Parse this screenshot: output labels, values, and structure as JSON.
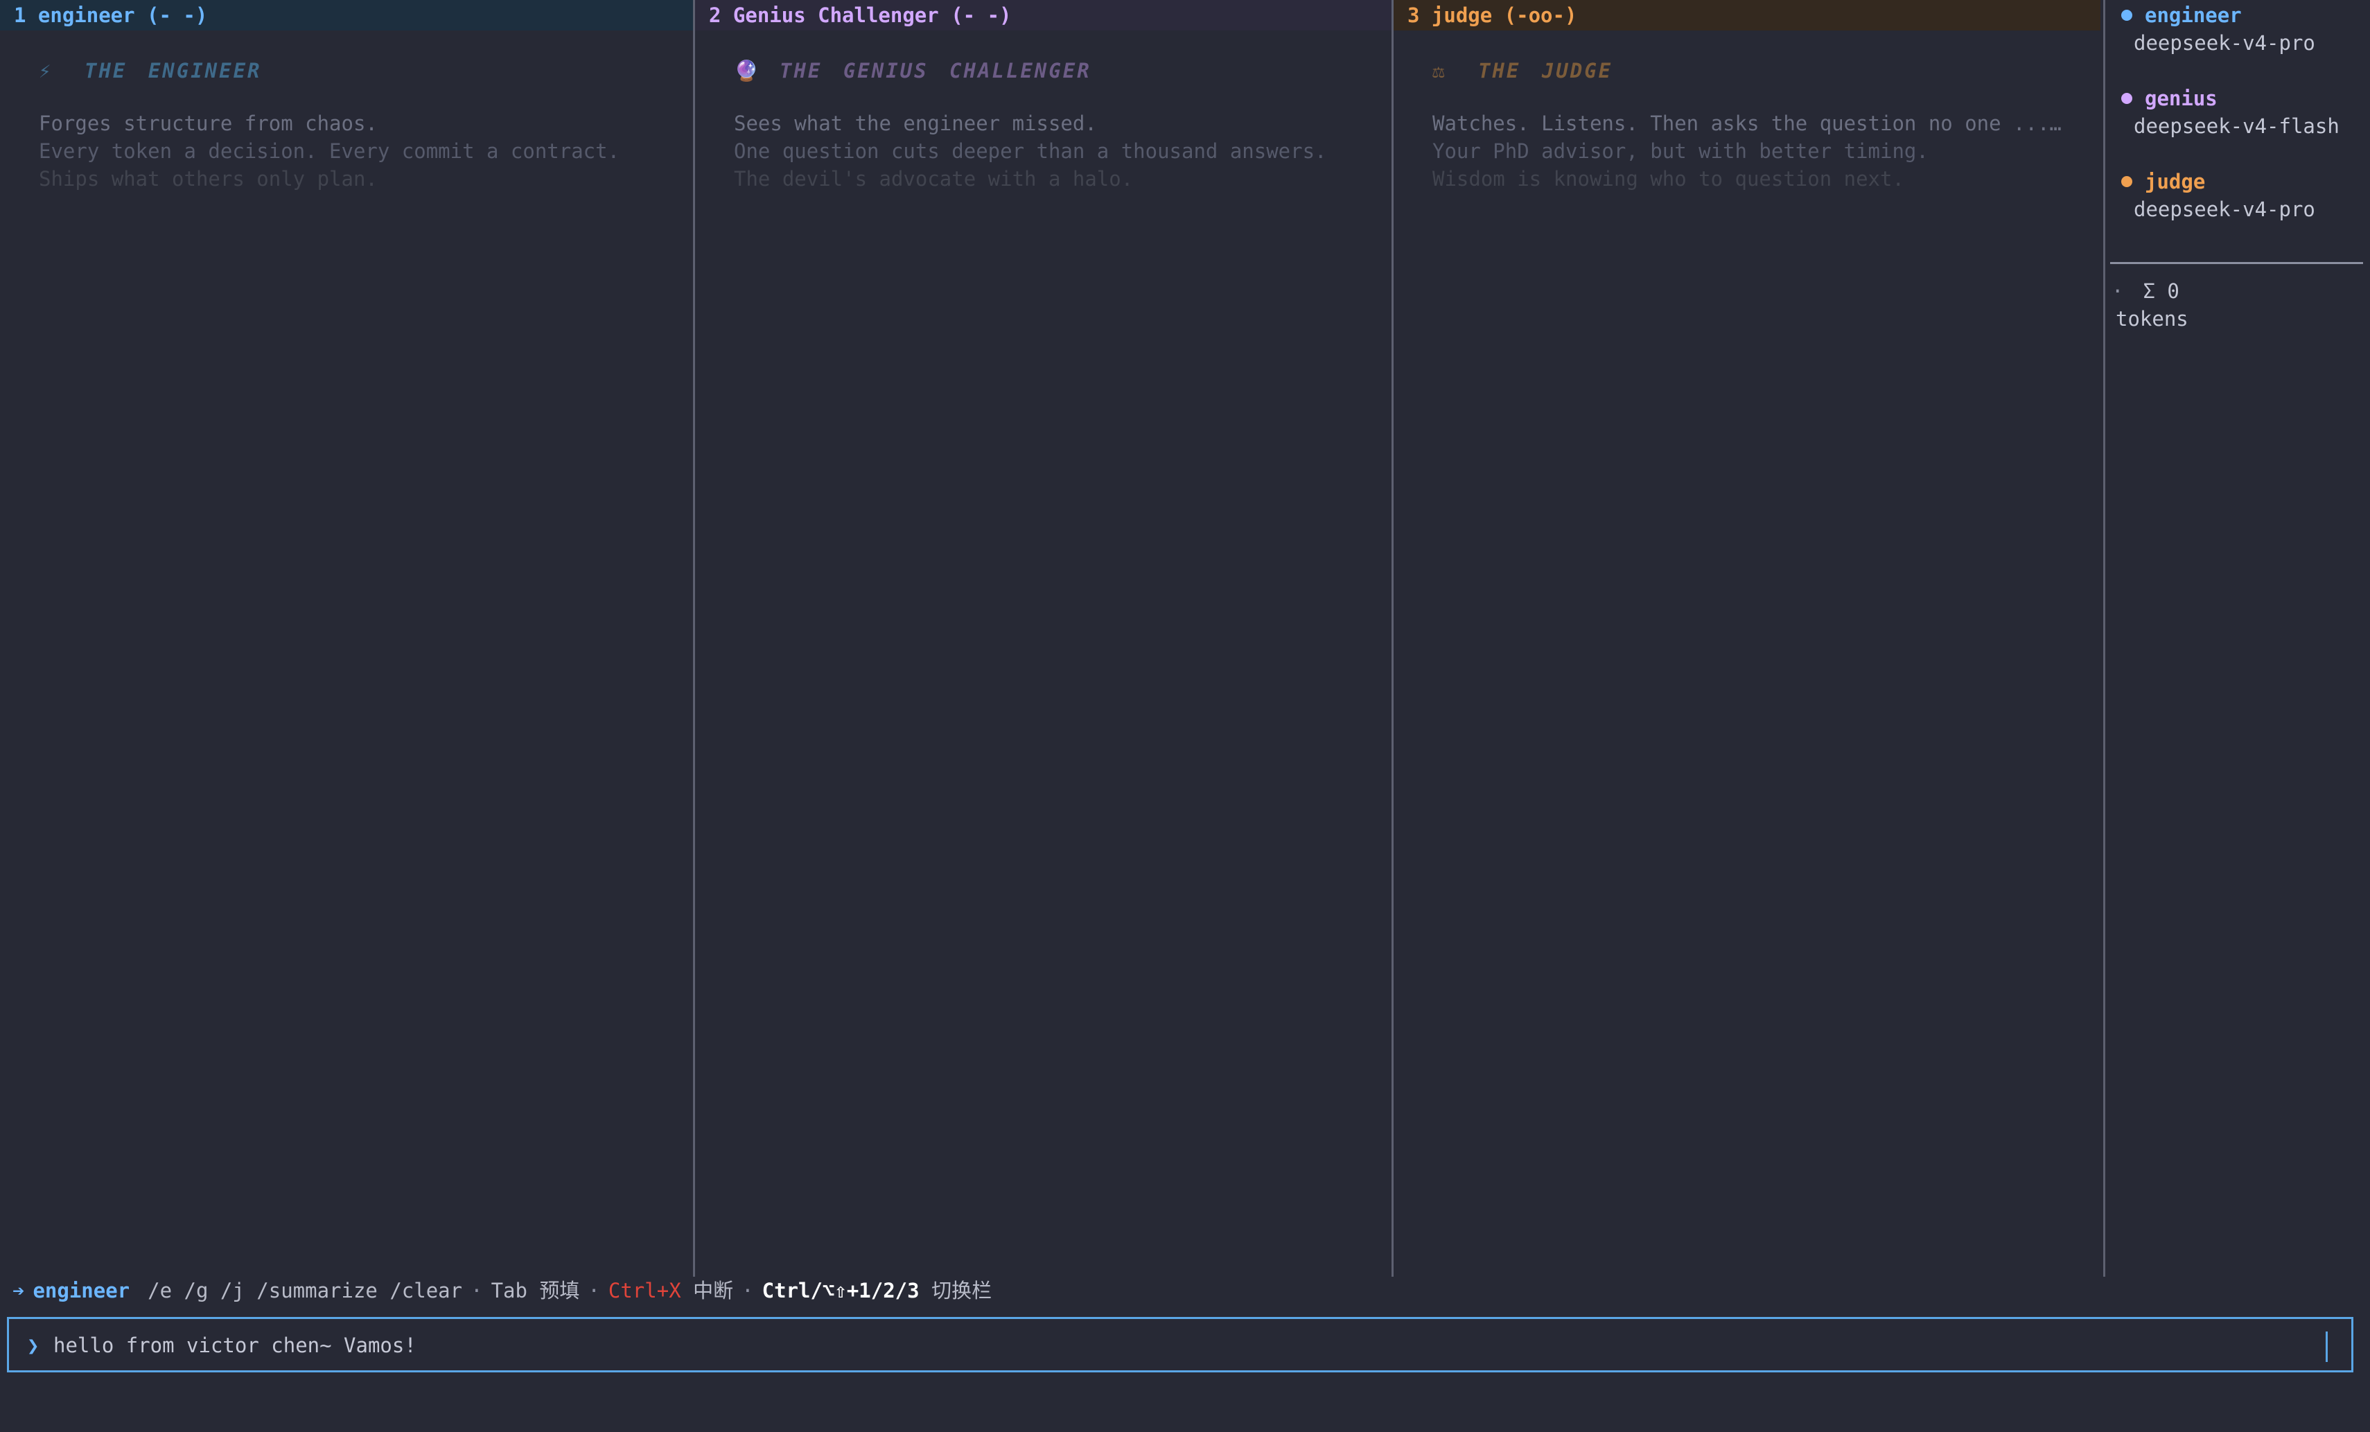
{
  "panes": [
    {
      "header": "1 engineer (- -)",
      "icon": "⚡",
      "title": "THE ENGINEER",
      "lines": [
        "Forges structure from chaos.",
        "Every token a decision. Every commit a contract.",
        "Ships what others only plan."
      ]
    },
    {
      "header": "2 Genius Challenger (-  -)",
      "icon": "🔮",
      "title": "THE GENIUS CHALLENGER",
      "lines": [
        "Sees what the engineer missed.",
        "One question cuts deeper than a thousand answers.",
        "The devil's advocate with a halo."
      ]
    },
    {
      "header": "3 judge (-oo-)",
      "icon": "⚖",
      "title": "THE JUDGE",
      "lines": [
        "Watches. Listens. Then asks the question no one ...…",
        "Your PhD advisor, but with better timing.",
        "Wisdom is knowing who to question next."
      ]
    }
  ],
  "sidebar": {
    "agents": [
      {
        "name": "engineer",
        "model": "deepseek-v4-pro",
        "color": "#6cb6ff"
      },
      {
        "name": "genius",
        "model": "deepseek-v4-flash",
        "color": "#d2a8ff"
      },
      {
        "name": "judge",
        "model": "deepseek-v4-pro",
        "color": "#f0a050"
      }
    ],
    "tokens_bullet": "·",
    "tokens_total": "Σ 0",
    "tokens_label": "tokens"
  },
  "status": {
    "arrow": "➔",
    "agent": "engineer",
    "commands": "/e /g /j /summarize /clear",
    "tab_hint": "Tab 预填",
    "interrupt_key": "Ctrl+X",
    "interrupt_label": "中断",
    "switch_key": "Ctrl/⌥⇧+1/2/3",
    "switch_label": "切换栏",
    "separator": "·"
  },
  "input": {
    "prompt": "❯",
    "value": "hello from victor chen~ Vamos!"
  },
  "colors": {
    "background": "#272935",
    "engineer": "#6cb6ff",
    "genius": "#d2a8ff",
    "judge": "#f0a050",
    "input_border": "#5aa6e6",
    "interrupt": "#e0443a"
  }
}
